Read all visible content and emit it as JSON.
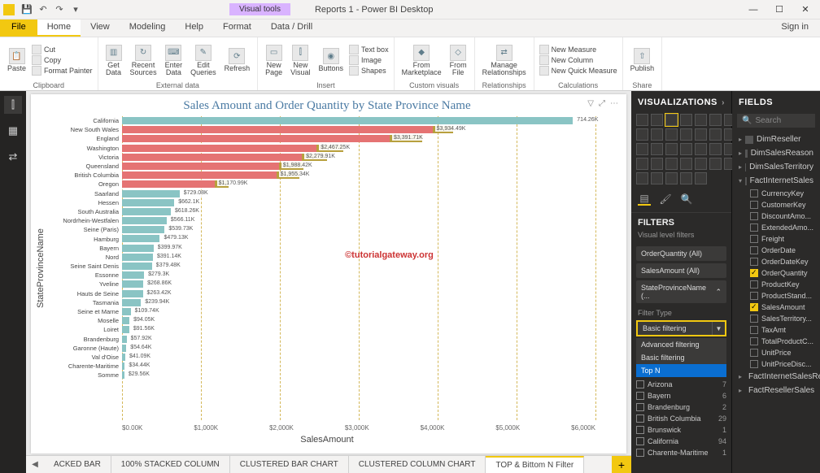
{
  "window": {
    "title": "Reports 1 - Power BI Desktop",
    "contextual_tab": "Visual tools",
    "signin": "Sign in"
  },
  "qat": {
    "save": "💾",
    "undo": "↶",
    "redo": "↷"
  },
  "menutabs": [
    "File",
    "Home",
    "View",
    "Modeling",
    "Help",
    "Format",
    "Data / Drill"
  ],
  "ribbon": {
    "clipboard": {
      "paste": "Paste",
      "cut": "Cut",
      "copy": "Copy",
      "format_painter": "Format Painter",
      "label": "Clipboard"
    },
    "external": {
      "getdata": "Get\nData",
      "recent": "Recent\nSources",
      "enter": "Enter\nData",
      "edit": "Edit\nQueries",
      "refresh": "Refresh",
      "label": "External data"
    },
    "insert": {
      "newpage": "New\nPage",
      "newvisual": "New\nVisual",
      "buttons": "Buttons",
      "textbox": "Text box",
      "image": "Image",
      "shapes": "Shapes",
      "label": "Insert"
    },
    "custom": {
      "market": "From\nMarketplace",
      "file": "From\nFile",
      "label": "Custom visuals"
    },
    "rel": {
      "manage": "Manage\nRelationships",
      "label": "Relationships"
    },
    "calc": {
      "measure": "New Measure",
      "column": "New Column",
      "quick": "New Quick Measure",
      "label": "Calculations"
    },
    "share": {
      "publish": "Publish",
      "label": "Share"
    }
  },
  "panes": {
    "viz": "VISUALIZATIONS",
    "filters": "FILTERS",
    "visual_level": "Visual level filters",
    "filter_items": [
      {
        "label": "OrderQuantity",
        "v": "(All)"
      },
      {
        "label": "SalesAmount",
        "v": "(All)"
      },
      {
        "label": "StateProvinceName",
        "v": "(...",
        "chev": true
      }
    ],
    "filter_type_lbl": "Filter Type",
    "filter_dd": "Basic filtering",
    "dd_options": [
      "Advanced filtering",
      "Basic filtering",
      "Top N"
    ],
    "dd_selected": "Top N",
    "filter_values": [
      {
        "n": "Arizona",
        "c": 7
      },
      {
        "n": "Bayern",
        "c": 6
      },
      {
        "n": "Brandenburg",
        "c": 2
      },
      {
        "n": "British Columbia",
        "c": 29
      },
      {
        "n": "Brunswick",
        "c": 1
      },
      {
        "n": "California",
        "c": 94
      },
      {
        "n": "Charente-Maritime",
        "c": 1
      }
    ],
    "fields": "FIELDS",
    "search_ph": "Search",
    "tables": [
      {
        "name": "DimReseller"
      },
      {
        "name": "DimSalesReason"
      },
      {
        "name": "DimSalesTerritory"
      },
      {
        "name": "FactInternetSales",
        "expanded": true,
        "fields": [
          {
            "n": "CurrencyKey"
          },
          {
            "n": "CustomerKey"
          },
          {
            "n": "DiscountAmo..."
          },
          {
            "n": "ExtendedAmo..."
          },
          {
            "n": "Freight"
          },
          {
            "n": "OrderDate"
          },
          {
            "n": "OrderDateKey"
          },
          {
            "n": "OrderQuantity",
            "checked": true
          },
          {
            "n": "ProductKey"
          },
          {
            "n": "ProductStand..."
          },
          {
            "n": "SalesAmount",
            "checked": true
          },
          {
            "n": "SalesTerritory..."
          },
          {
            "n": "TaxAmt"
          },
          {
            "n": "TotalProductC..."
          },
          {
            "n": "UnitPrice"
          },
          {
            "n": "UnitPriceDisc..."
          }
        ]
      },
      {
        "name": "FactInternetSalesRe..."
      },
      {
        "name": "FactResellerSales"
      }
    ]
  },
  "page_tabs": {
    "items": [
      "ACKED BAR",
      "100% STACKED COLUMN",
      "CLUSTERED BAR CHART",
      "CLUSTERED COLUMN CHART",
      "TOP & Bittom N Filter"
    ],
    "active": 4
  },
  "chart": {
    "title": "Sales Amount and Order Quantity by State Province Name",
    "ylabel": "StateProvinceName",
    "xlabel": "SalesAmount",
    "watermark": "©tutorialgateway.org",
    "xticks": [
      "$0.00K",
      "$1,000K",
      "$2,000K",
      "$3,000K",
      "$4,000K",
      "$5,000K",
      "$6,000K"
    ]
  },
  "chart_data": {
    "type": "bar",
    "xlabel": "SalesAmount",
    "ylabel": "StateProvinceName",
    "xlim": [
      0,
      6000
    ],
    "categories": [
      "California",
      "New South Wales",
      "England",
      "Washington",
      "Victoria",
      "Queensland",
      "British Columbia",
      "Oregon",
      "Saarland",
      "Hessen",
      "South Australia",
      "Nordrhein-Westfalen",
      "Seine (Paris)",
      "Hamburg",
      "Bayern",
      "Nord",
      "Seine Saint Denis",
      "Essonne",
      "Yveline",
      "Hauts de Seine",
      "Tasmania",
      "Seine et Marne",
      "Moselle",
      "Loiret",
      "Brandenburg",
      "Garonne (Haute)",
      "Val d'Oise",
      "Charente-Maritime",
      "Somme"
    ],
    "series": [
      {
        "name": "SalesAmount_gold",
        "color": "#b8a03e",
        "values": [
          5714.26,
          4200,
          3800,
          2800,
          2600,
          2300,
          2250,
          1350,
          729.08,
          662.1,
          618.26,
          566.11,
          539.73,
          479.13,
          399.97,
          391.14,
          379.48,
          279.3,
          268.86,
          263.42,
          239.94,
          109.74,
          94.05,
          91.56,
          57.92,
          54.64,
          41.09,
          34.44,
          29.56
        ],
        "labels": [
          "714.26K",
          null,
          null,
          null,
          null,
          null,
          null,
          null,
          "$729.08K",
          "$662.1K",
          "$618.26K",
          "$566.11K",
          "$539.73K",
          "$479.13K",
          "$399.97K",
          "$391.14K",
          "$379.48K",
          "$279.3K",
          "$268.86K",
          "$263.42K",
          "$239.94K",
          "$109.74K",
          "$94.05K",
          "$91.56K",
          "$57.92K",
          "$54.64K",
          "$41.09K",
          "$34.44K",
          "$29.56K"
        ]
      },
      {
        "name": "SalesAmount_red",
        "color": "#e57373",
        "values": [
          null,
          3934.49,
          3391.71,
          2467.25,
          2279.91,
          1988.42,
          1955.34,
          1170.99,
          null,
          null,
          null,
          null,
          null,
          null,
          null,
          null,
          null,
          null,
          null,
          null,
          null,
          null,
          null,
          null,
          null,
          null,
          null,
          null,
          null
        ],
        "labels": [
          null,
          "$3,934.49K",
          "$3,391.71K",
          "$2,467.25K",
          "$2,279.91K",
          "$1,988.42K",
          "$1,955.34K",
          "$1,170.99K",
          null,
          null,
          null,
          null,
          null,
          null,
          null,
          null,
          null,
          null,
          null,
          null,
          null,
          null,
          null,
          null,
          null,
          null,
          null,
          null,
          null
        ]
      }
    ]
  }
}
